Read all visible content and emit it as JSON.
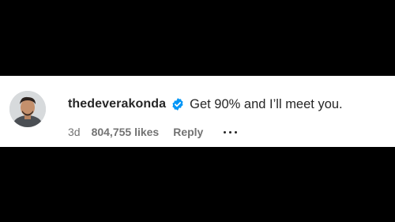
{
  "comment": {
    "username": "thedeverakonda",
    "verified_icon": "verified-badge-icon",
    "verified_color": "#0095f6",
    "text": "Get 90% and I’ll meet you.",
    "age": "3d",
    "likes": "804,755 likes",
    "reply_label": "Reply",
    "more_icon": "more-options-icon"
  }
}
